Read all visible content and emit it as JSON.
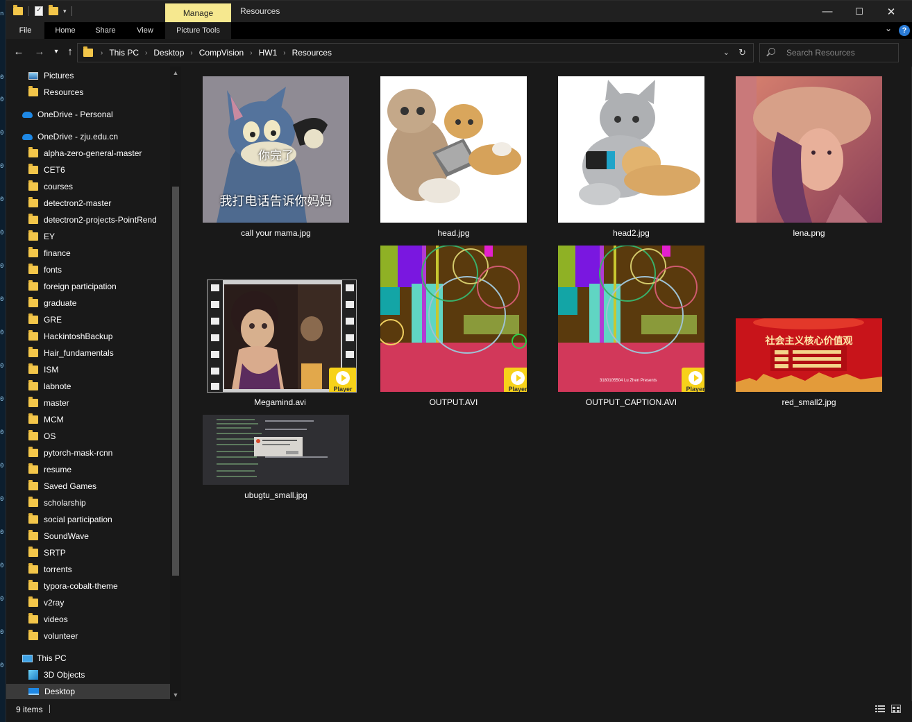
{
  "window": {
    "title": "Resources",
    "contextual_tab": "Manage",
    "controls": {
      "minimize": "—",
      "maximize": "☐",
      "close": "✕"
    }
  },
  "ribbon": {
    "tabs": [
      "File",
      "Home",
      "Share",
      "View",
      "Picture Tools"
    ],
    "help": "?"
  },
  "address": {
    "breadcrumbs": [
      "This PC",
      "Desktop",
      "CompVision",
      "HW1",
      "Resources"
    ],
    "search_placeholder": "Search Resources"
  },
  "navigation": {
    "items": [
      {
        "label": "Pictures",
        "icon": "pictures-icon"
      },
      {
        "label": "Resources",
        "icon": "folder-icon"
      },
      {
        "label": "OneDrive - Personal",
        "icon": "onedrive-icon"
      },
      {
        "label": "OneDrive - zju.edu.cn",
        "icon": "onedrive-icon"
      },
      {
        "label": "alpha-zero-general-master",
        "icon": "folder-icon"
      },
      {
        "label": "CET6",
        "icon": "folder-icon"
      },
      {
        "label": "courses",
        "icon": "folder-icon"
      },
      {
        "label": "detectron2-master",
        "icon": "folder-icon"
      },
      {
        "label": "detectron2-projects-PointRend",
        "icon": "folder-icon"
      },
      {
        "label": "EY",
        "icon": "folder-icon"
      },
      {
        "label": "finance",
        "icon": "folder-icon"
      },
      {
        "label": "fonts",
        "icon": "folder-icon"
      },
      {
        "label": "foreign participation",
        "icon": "folder-icon"
      },
      {
        "label": "graduate",
        "icon": "folder-icon"
      },
      {
        "label": "GRE",
        "icon": "folder-icon"
      },
      {
        "label": "HackintoshBackup",
        "icon": "folder-icon"
      },
      {
        "label": "Hair_fundamentals",
        "icon": "folder-icon"
      },
      {
        "label": "ISM",
        "icon": "folder-icon"
      },
      {
        "label": "labnote",
        "icon": "folder-icon"
      },
      {
        "label": "master",
        "icon": "folder-icon"
      },
      {
        "label": "MCM",
        "icon": "folder-icon"
      },
      {
        "label": "OS",
        "icon": "folder-icon"
      },
      {
        "label": "pytorch-mask-rcnn",
        "icon": "folder-icon"
      },
      {
        "label": "resume",
        "icon": "folder-icon"
      },
      {
        "label": "Saved Games",
        "icon": "folder-icon"
      },
      {
        "label": "scholarship",
        "icon": "folder-icon"
      },
      {
        "label": "social participation",
        "icon": "folder-icon"
      },
      {
        "label": "SoundWave",
        "icon": "folder-icon"
      },
      {
        "label": "SRTP",
        "icon": "folder-icon"
      },
      {
        "label": "torrents",
        "icon": "folder-icon"
      },
      {
        "label": "typora-cobalt-theme",
        "icon": "folder-icon"
      },
      {
        "label": "v2ray",
        "icon": "folder-icon"
      },
      {
        "label": "videos",
        "icon": "folder-icon"
      },
      {
        "label": "volunteer",
        "icon": "folder-icon"
      },
      {
        "label": "This PC",
        "icon": "this-pc-icon"
      },
      {
        "label": "3D Objects",
        "icon": "3d-objects-icon"
      },
      {
        "label": "Desktop",
        "icon": "desktop-icon",
        "selected": true
      }
    ]
  },
  "files": [
    {
      "name": "call your mama.jpg",
      "kind": "image",
      "overlay_top": "你完了",
      "overlay_bottom": "我打电话告诉你妈妈"
    },
    {
      "name": "head.jpg",
      "kind": "image"
    },
    {
      "name": "head2.jpg",
      "kind": "image"
    },
    {
      "name": "lena.png",
      "kind": "image"
    },
    {
      "name": "Megamind.avi",
      "kind": "video",
      "badge": "Player"
    },
    {
      "name": "OUTPUT.AVI",
      "kind": "video",
      "badge": "Player"
    },
    {
      "name": "OUTPUT_CAPTION.AVI",
      "kind": "video",
      "badge": "Player",
      "caption": "3180105504 Lu Zhen Presents"
    },
    {
      "name": "red_small2.jpg",
      "kind": "image",
      "overlay_top": "社会主义核心价值观"
    },
    {
      "name": "ubugtu_small.jpg",
      "kind": "image"
    }
  ],
  "status": {
    "item_count": "9 items"
  },
  "colors": {
    "manage_tab": "#f6e88f",
    "player_badge": "#f7d21a",
    "folder": "#f3c64a"
  }
}
